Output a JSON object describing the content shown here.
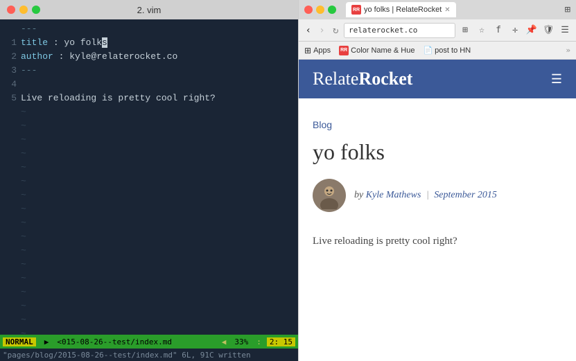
{
  "vim": {
    "title": "2. vim",
    "lines": [
      {
        "num": "",
        "content": "---",
        "type": "separator"
      },
      {
        "num": "1",
        "key": "title",
        "value": "yo folk",
        "cursor": true
      },
      {
        "num": "2",
        "key": "author",
        "value": "kyle@relaterocket.co"
      },
      {
        "num": "3",
        "content": "---",
        "type": "separator"
      },
      {
        "num": "4",
        "content": ""
      },
      {
        "num": "5",
        "content": "Live reloading is pretty cool right?"
      }
    ],
    "status": {
      "mode": "NORMAL",
      "filename": "<015-08-26--test/index.md",
      "percent": "33%",
      "line": "2",
      "col": "15",
      "written": "\"pages/blog/2015-08-26--test/index.md\" 6L, 91C written"
    }
  },
  "browser": {
    "tab": {
      "label": "yo folks | RelateRocket",
      "favicon": "RR"
    },
    "address": "relaterocket.co",
    "nav": {
      "back": "‹",
      "forward": "›",
      "refresh": "↻"
    },
    "bookmarks": [
      {
        "type": "apps",
        "label": "Apps"
      },
      {
        "type": "rr",
        "label": "Color Name & Hue"
      },
      {
        "type": "doc",
        "label": "post to HN"
      }
    ],
    "site": {
      "logo_normal": "Relate",
      "logo_bold": "Rocket",
      "header_menu_icon": "☰"
    },
    "page": {
      "breadcrumb": "Blog",
      "title": "yo folks",
      "author_prefix": "by ",
      "author_name": "Kyle Mathews",
      "author_sep": "|",
      "author_date": "September 2015",
      "excerpt": "Live reloading is pretty cool right?"
    }
  }
}
